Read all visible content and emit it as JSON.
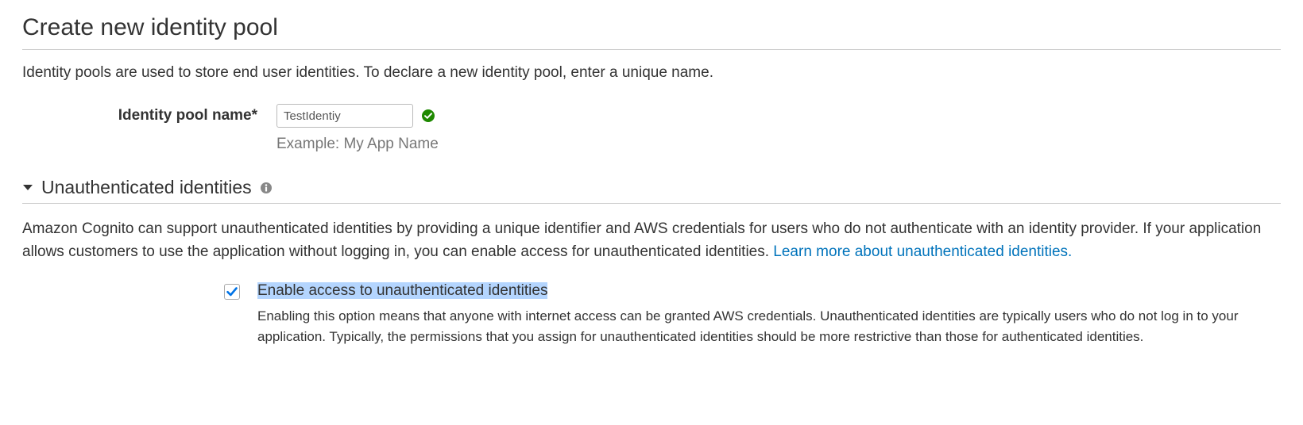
{
  "page": {
    "title": "Create new identity pool",
    "intro": "Identity pools are used to store end user identities. To declare a new identity pool, enter a unique name."
  },
  "fields": {
    "pool_name": {
      "label": "Identity pool name*",
      "value": "TestIdentiy",
      "example": "Example: My App Name"
    }
  },
  "sections": {
    "unauth": {
      "title": "Unauthenticated identities",
      "desc_part1": "Amazon Cognito can support unauthenticated identities by providing a unique identifier and AWS credentials for users who do not authenticate with an identity provider. If your application allows customers to use the application without logging in, you can enable access for unauthenticated identities. ",
      "link_text": "Learn more about unauthenticated identities.",
      "checkbox": {
        "label": "Enable access to unauthenticated identities",
        "help": "Enabling this option means that anyone with internet access can be granted AWS credentials. Unauthenticated identities are typically users who do not log in to your application. Typically, the permissions that you assign for unauthenticated identities should be more restrictive than those for authenticated identities."
      }
    }
  }
}
